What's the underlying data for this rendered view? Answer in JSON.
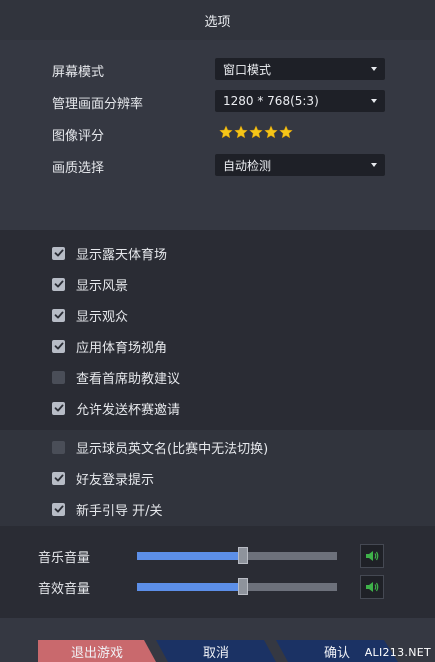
{
  "window": {
    "title": "选项"
  },
  "display": {
    "screen_mode": {
      "label": "屏幕模式",
      "value": "窗口模式"
    },
    "resolution": {
      "label": "管理画面分辨率",
      "value": "1280 * 768(5:3)"
    },
    "image_rating": {
      "label": "图像评分",
      "stars": 5,
      "star_color": "#f5c518"
    },
    "quality": {
      "label": "画质选择",
      "value": "自动检测"
    }
  },
  "checks_group1": [
    {
      "label": "显示露天体育场",
      "checked": true
    },
    {
      "label": "显示风景",
      "checked": true
    },
    {
      "label": "显示观众",
      "checked": true
    },
    {
      "label": "应用体育场视角",
      "checked": true
    },
    {
      "label": "查看首席助教建议",
      "checked": false
    },
    {
      "label": "允许发送杯赛邀请",
      "checked": true
    }
  ],
  "checks_group2": [
    {
      "label": "显示球员英文名(比赛中无法切换)",
      "checked": false
    },
    {
      "label": "好友登录提示",
      "checked": true
    },
    {
      "label": "新手引导 开/关",
      "checked": true
    }
  ],
  "audio": {
    "music": {
      "label": "音乐音量",
      "level_pct": 53
    },
    "effects": {
      "label": "音效音量",
      "level_pct": 53
    },
    "speaker_color": "#3fb24a"
  },
  "footer": {
    "exit_label": "退出游戏",
    "cancel_label": "取消",
    "confirm_label": "确认"
  },
  "watermark": "ALI213.NET",
  "colors": {
    "accent_blue": "#5c8fe8",
    "exit_button": "#c9696d",
    "primary_button": "#1b3264"
  }
}
